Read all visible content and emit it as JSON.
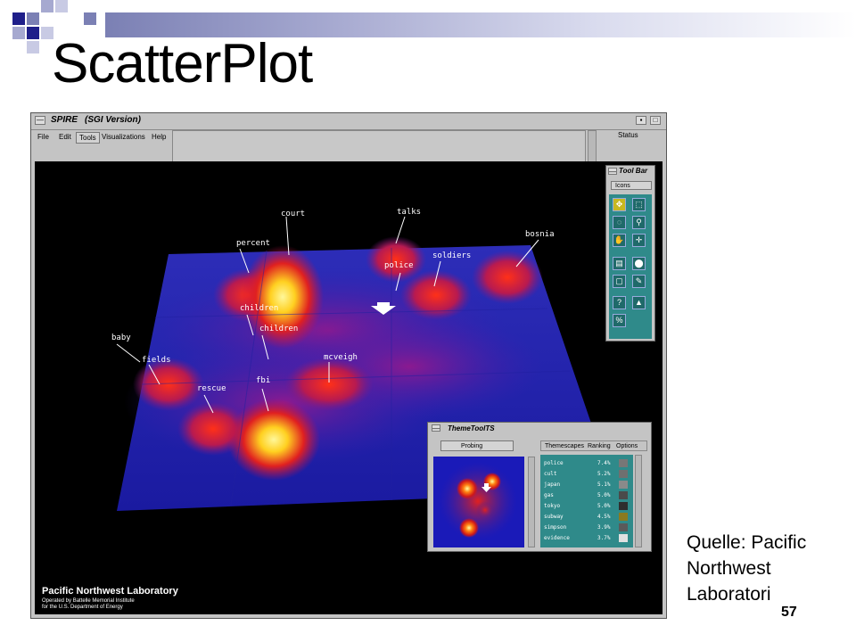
{
  "slide": {
    "title": "ScatterPlot",
    "source_line1": "Quelle: Pacific",
    "source_line2": "Northwest",
    "source_line3": "Laboratori",
    "page_number": "57"
  },
  "window": {
    "title": "SPIRE",
    "version": "(SGI Version)",
    "status_label": "Status",
    "menu": [
      "File",
      "Edit",
      "Tools",
      "Visualizations",
      "Help"
    ],
    "active_menu": "Tools"
  },
  "landscape": {
    "terms": [
      "court",
      "talks",
      "bosnia",
      "percent",
      "police",
      "soldiers",
      "children",
      "children",
      "baby",
      "fields",
      "mcveigh",
      "fbi",
      "rescue"
    ]
  },
  "logo": {
    "name": "Pacific Northwest Laboratory",
    "line1": "Operated by Battelle Memorial Institute",
    "line2": "for the U.S. Department of Energy"
  },
  "toolbar": {
    "title": "Tool Bar",
    "selector": "Icons"
  },
  "themetool": {
    "title": "ThemeToolTS",
    "probe_label": "Probing",
    "tabs": [
      "Themescapes",
      "Ranking",
      "Options"
    ],
    "themes": [
      {
        "name": "police",
        "pct": "7.4%",
        "color": "#777777"
      },
      {
        "name": "cult",
        "pct": "5.2%",
        "color": "#6f6f6f"
      },
      {
        "name": "japan",
        "pct": "5.1%",
        "color": "#8a8a8a"
      },
      {
        "name": "gas",
        "pct": "5.0%",
        "color": "#4a4a4a"
      },
      {
        "name": "tokyo",
        "pct": "5.0%",
        "color": "#2e2e2e"
      },
      {
        "name": "subway",
        "pct": "4.5%",
        "color": "#8a7a20"
      },
      {
        "name": "simpson",
        "pct": "3.9%",
        "color": "#5a5a5a"
      },
      {
        "name": "evidence",
        "pct": "3.7%",
        "color": "#e0e0e0"
      }
    ]
  }
}
